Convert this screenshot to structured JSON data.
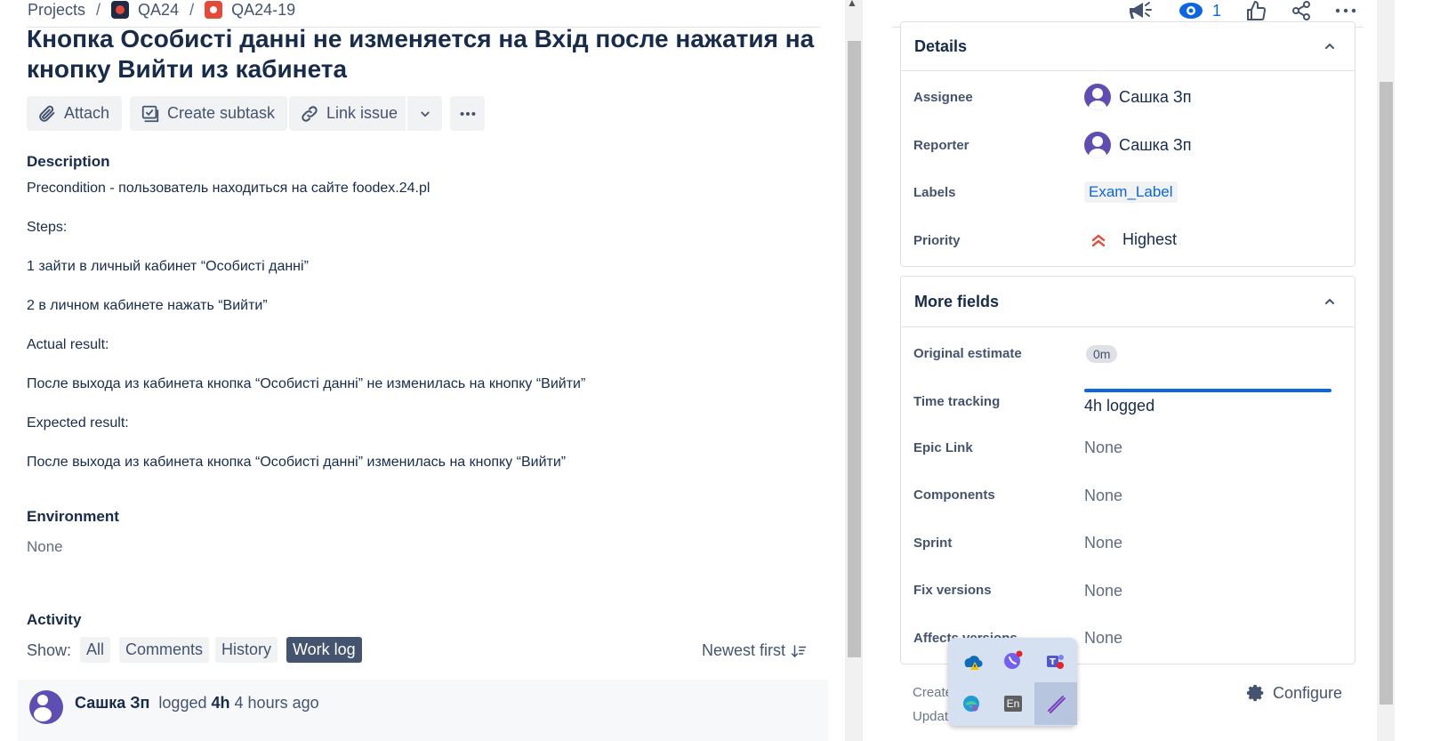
{
  "breadcrumbs": {
    "projects": "Projects",
    "project": "QA24",
    "issue_key": "QA24-19"
  },
  "issue": {
    "title": "Кнопка Особисті данні не изменяется на Вхід после нажатия на кнопку Вийти из кабинета"
  },
  "toolbar": {
    "attach": "Attach",
    "create_subtask": "Create subtask",
    "link_issue": "Link issue"
  },
  "description": {
    "heading": "Description",
    "lines": [
      "Precondition - пользователь находиться на сайте  foodex.24.pl",
      "Steps:",
      "1 зайти в личный кабинет “Особисті данні”",
      "2 в личном кабинете нажать “Вийти”",
      "Actual result:",
      "После выхода из кабинета кнопка “Особисті данні” не изменилась на кнопку “Вийти”",
      "Expected result:",
      "После выхода из кабинета кнопка “Особисті данні”  изменилась на кнопку “Вийти”"
    ]
  },
  "environment": {
    "heading": "Environment",
    "value": "None"
  },
  "activity": {
    "heading": "Activity",
    "show_label": "Show:",
    "filters": [
      "All",
      "Comments",
      "History",
      "Work log"
    ],
    "active_filter": "Work log",
    "sort": "Newest first",
    "entry": {
      "user": "Сашка Зп",
      "action": "logged",
      "amount": "4h",
      "when": "4 hours ago"
    }
  },
  "header_actions": {
    "watch_count": "1"
  },
  "details": {
    "heading": "Details",
    "fields": {
      "assignee_label": "Assignee",
      "assignee": "Сашка Зп",
      "reporter_label": "Reporter",
      "reporter": "Сашка Зп",
      "labels_label": "Labels",
      "labels": "Exam_Label",
      "priority_label": "Priority",
      "priority": "Highest"
    }
  },
  "more_fields": {
    "heading": "More fields",
    "original_estimate_label": "Original estimate",
    "original_estimate": "0m",
    "time_tracking_label": "Time tracking",
    "time_tracking": "4h logged",
    "time_tracking_fill": 1.0,
    "epic_link_label": "Epic Link",
    "epic_link": "None",
    "components_label": "Components",
    "components": "None",
    "sprint_label": "Sprint",
    "sprint": "None",
    "fix_versions_label": "Fix versions",
    "fix_versions": "None",
    "affects_versions_label": "Affects versions",
    "affects_versions": "None"
  },
  "footer": {
    "created": "Create",
    "updated": "Updat",
    "configure": "Configure"
  },
  "tray": {
    "language": "En"
  },
  "colors": {
    "link": "#0c66e4",
    "priority_highest": "#e5493a",
    "avatar": "#5e4db2",
    "active_pill": "#44546f"
  }
}
